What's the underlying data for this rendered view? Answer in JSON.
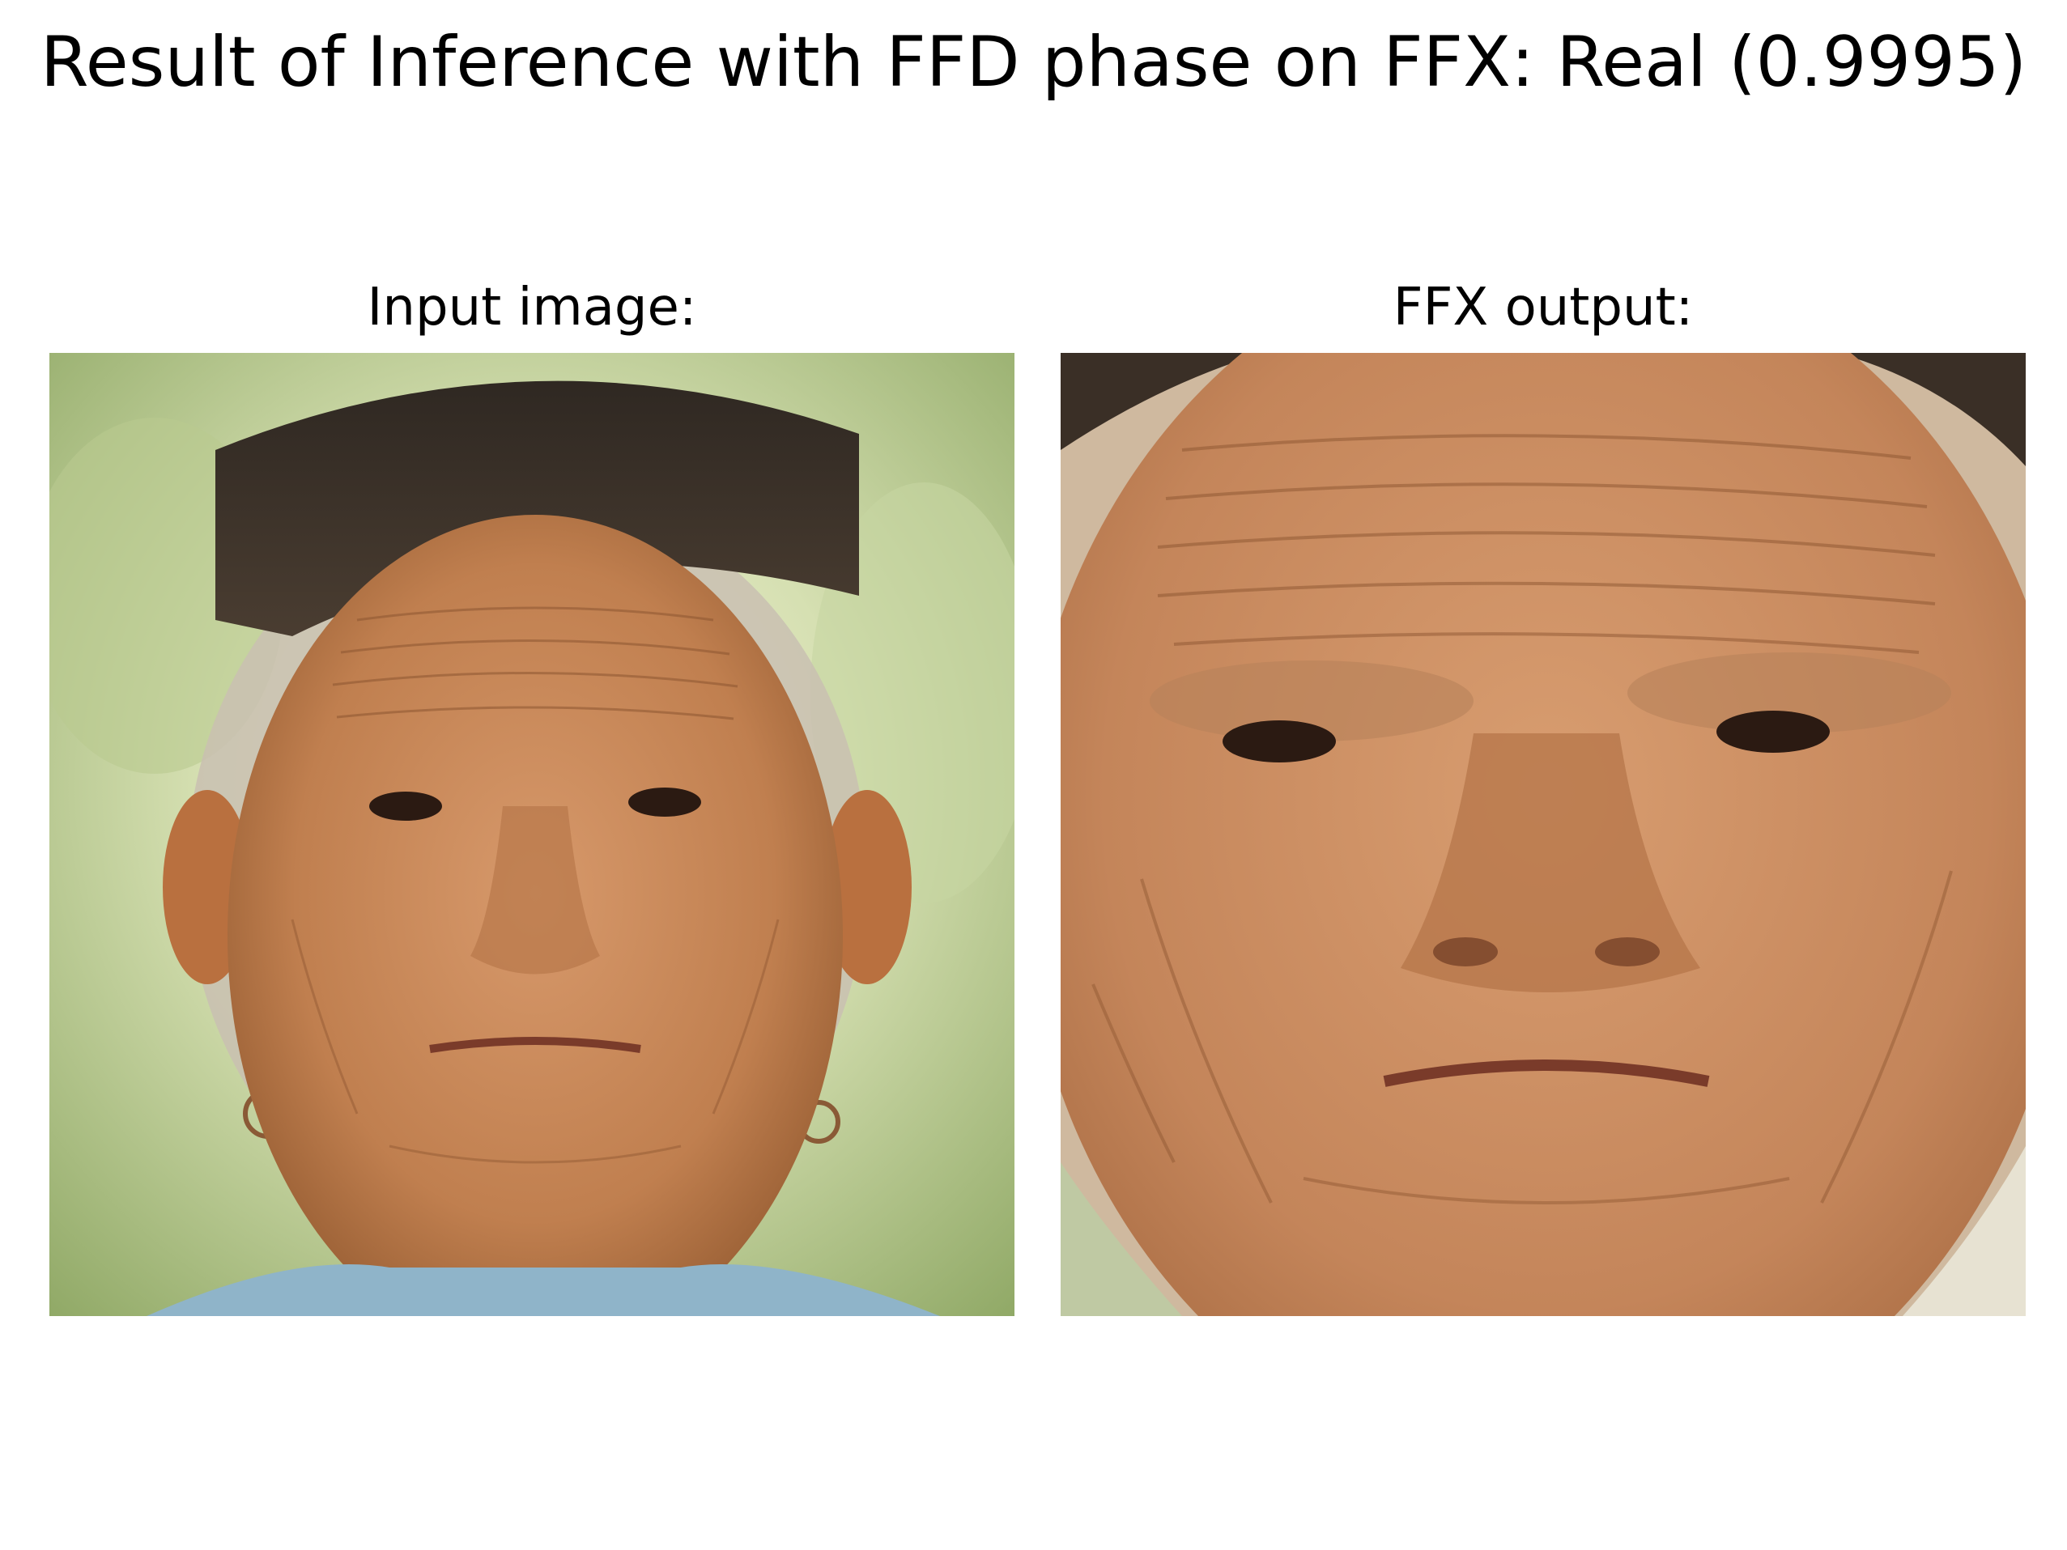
{
  "figure": {
    "title": "Result of Inference with FFD phase on FFX: Real (0.9995)"
  },
  "panels": [
    {
      "title": "Input image:"
    },
    {
      "title": "FFX output:"
    }
  ],
  "palette": {
    "background": "#ffffff",
    "text": "#000000",
    "skin": "#c98a5a",
    "skin_shadow": "#9b5f36",
    "hat": "#3a2f26",
    "foliage": "#a9bf7e",
    "hair": "#b7aea0"
  }
}
